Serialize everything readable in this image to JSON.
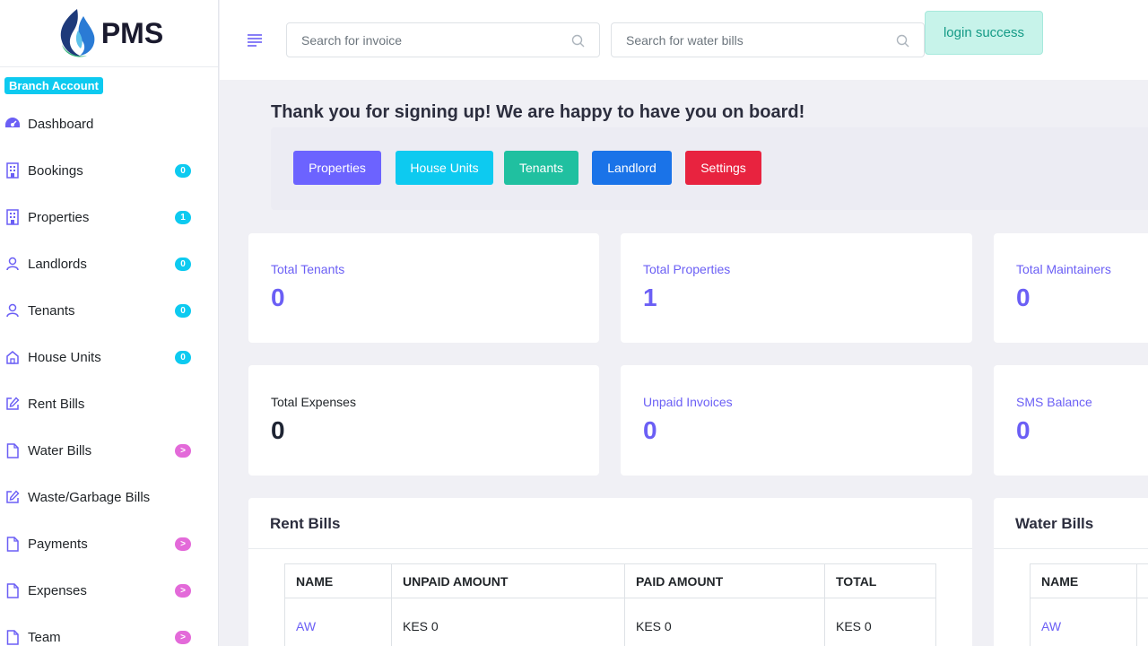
{
  "brand": {
    "name": "PMS"
  },
  "sidebar": {
    "branch_badge": "Branch Account",
    "items": [
      {
        "label": "Dashboard",
        "icon": "dashboard-icon",
        "badge": ""
      },
      {
        "label": "Bookings",
        "icon": "building-icon",
        "badge": "0"
      },
      {
        "label": "Properties",
        "icon": "building-icon",
        "badge": "1"
      },
      {
        "label": "Landlords",
        "icon": "user-icon",
        "badge": "0"
      },
      {
        "label": "Tenants",
        "icon": "user-icon",
        "badge": "0"
      },
      {
        "label": "House Units",
        "icon": "home-icon",
        "badge": "0"
      },
      {
        "label": "Rent Bills",
        "icon": "edit-icon",
        "badge": ""
      },
      {
        "label": "Water Bills",
        "icon": "file-icon",
        "badge": ">"
      },
      {
        "label": "Waste/Garbage Bills",
        "icon": "edit-icon",
        "badge": ""
      },
      {
        "label": "Payments",
        "icon": "file-icon",
        "badge": ">"
      },
      {
        "label": "Expenses",
        "icon": "file-icon",
        "badge": ">"
      },
      {
        "label": "Team",
        "icon": "file-icon",
        "badge": ">"
      }
    ]
  },
  "header": {
    "search_invoice_placeholder": "Search for invoice",
    "search_water_placeholder": "Search for water bills",
    "toast": "login success"
  },
  "welcome": {
    "title": "Thank you for signing up! We are happy to have you on board!",
    "buttons": [
      {
        "label": "Properties",
        "color": "#6c63ff"
      },
      {
        "label": "House Units",
        "color": "#0dcaf0"
      },
      {
        "label": "Tenants",
        "color": "#20c0a0"
      },
      {
        "label": "Landlord",
        "color": "#1a73e8"
      },
      {
        "label": "Settings",
        "color": "#e8233f"
      }
    ]
  },
  "stats": [
    {
      "label": "Total Tenants",
      "value": "0"
    },
    {
      "label": "Total Properties",
      "value": "1"
    },
    {
      "label": "Total Maintainers",
      "value": "0"
    },
    {
      "label": "Total Expenses",
      "value": "0"
    },
    {
      "label": "Unpaid Invoices",
      "value": "0"
    },
    {
      "label": "SMS Balance",
      "value": "0"
    }
  ],
  "rent_bills": {
    "title": "Rent Bills",
    "columns": [
      "NAME",
      "UNPAID AMOUNT",
      "PAID AMOUNT",
      "TOTAL"
    ],
    "rows": [
      {
        "name": "AW",
        "unpaid": "KES 0",
        "paid": "KES 0",
        "total": "KES 0"
      }
    ]
  },
  "water_bills": {
    "title": "Water Bills",
    "columns": [
      "NAME"
    ],
    "rows": [
      {
        "name": "AW"
      }
    ]
  },
  "colors": {
    "accent": "#6b5ff5",
    "badge_blue": "#0dcaf0",
    "badge_pink": "#e36ad9",
    "toast_bg": "#c7f3ea"
  }
}
